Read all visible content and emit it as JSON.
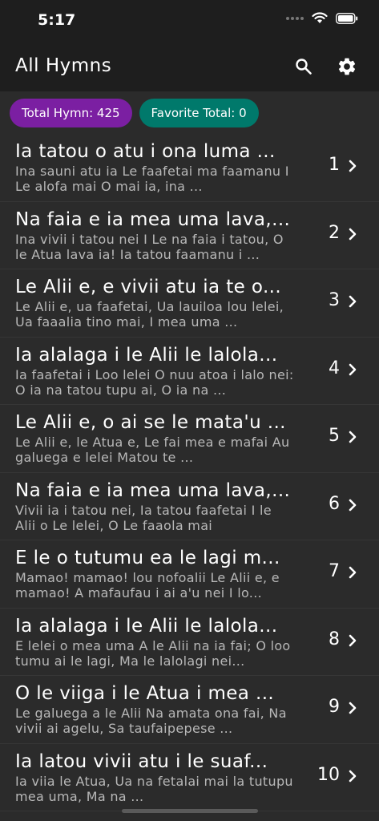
{
  "status": {
    "time": "5:17"
  },
  "app_bar": {
    "title": "All Hymns"
  },
  "chips": {
    "total": "Total Hymn: 425",
    "favorite": "Favorite Total: 0"
  },
  "hymns": [
    {
      "title": "Ia tatou o atu i ona luma ...",
      "excerpt": "Ina sauni atu ia Le faafetai ma faamanu I Le alofa mai O mai ia, ina ...",
      "number": "1"
    },
    {
      "title": "Na faia e ia mea uma lava,...",
      "excerpt": "Ina vivii i tatou nei I Le na faia i tatou, O le Atua lava ia! Ia tatou faamanu i ...",
      "number": "2"
    },
    {
      "title": "Le Alii e, e vivii atu ia te o...",
      "excerpt": "Le Alii e, ua faafetai, Ua lauiloa lou lelei, Ua faaalia tino mai, I mea uma ...",
      "number": "3"
    },
    {
      "title": "Ia alalaga i le Alii le lalola...",
      "excerpt": "Ia faafetai i Loo lelei O nuu atoa i lalo nei: O ia na tatou tupu ai, O ia na ...",
      "number": "4"
    },
    {
      "title": "Le Alii e, o ai se le mata'u ...",
      "excerpt": "Le Alii e, le Atua e, Le fai mea e mafai Au galuega e lelei Matou te ...",
      "number": "5"
    },
    {
      "title": "Na faia e ia mea uma lava,...",
      "excerpt": "Vivii ia i tatou nei, Ia tatou faafetai I le Alii o Le lelei, O Le faaola mai",
      "number": "6"
    },
    {
      "title": "E le o tutumu ea le lagi m...",
      "excerpt": "Mamao! mamao! lou nofoalii Le Alii e, e mamao! A mafaufau i ai a'u nei I lo...",
      "number": "7"
    },
    {
      "title": "Ia alalaga i le Alii le lalola...",
      "excerpt": "E lelei o mea uma A le Alii na ia fai; O loo tumu ai le lagi, Ma le lalolagi nei...",
      "number": "8"
    },
    {
      "title": "O le viiga i le Atua i mea ...",
      "excerpt": "Le galuega a le Alii Na amata ona fai, Na vivii ai agelu, Sa taufaipepese ...",
      "number": "9"
    },
    {
      "title": "Ia latou vivii atu i le suaf...",
      "excerpt": "Ia viia le Atua, Ua na fetalai mai la tutupu mea uma, Ma na ...",
      "number": "10"
    }
  ]
}
